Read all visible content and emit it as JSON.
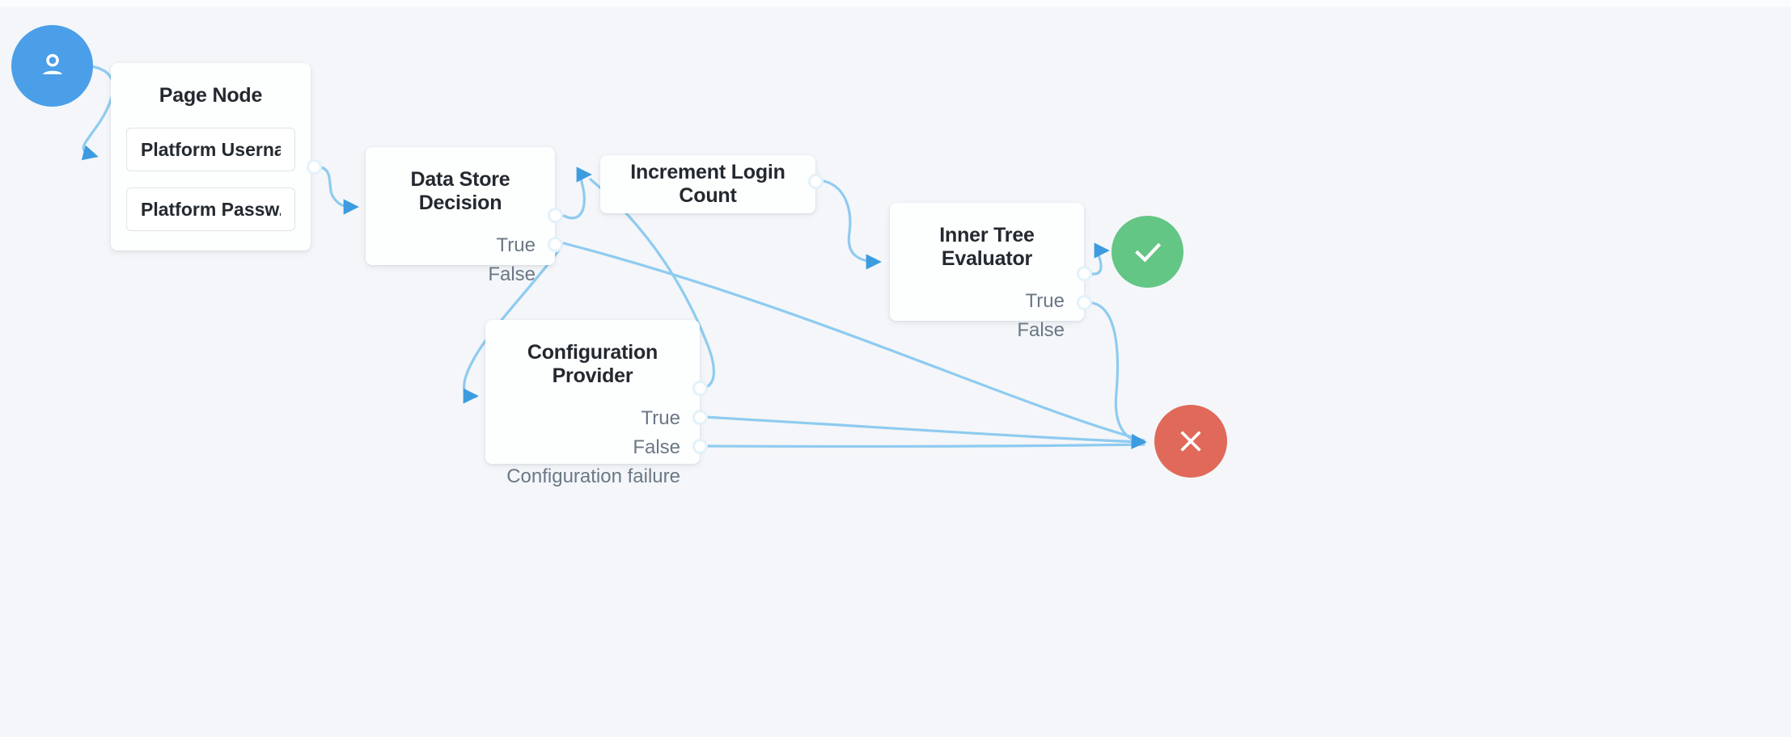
{
  "canvas": {
    "background_color": "#f4f6f9",
    "edge_color": "#8ecbf0",
    "arrow_color": "#3d9be0"
  },
  "terminals": {
    "start": {
      "name": "Start",
      "icon": "user-icon",
      "color": "#4a9fe8"
    },
    "success": {
      "name": "Success",
      "icon": "check-icon",
      "color": "#63c684"
    },
    "failure": {
      "name": "Failure",
      "icon": "close-icon",
      "color": "#e0695a"
    }
  },
  "nodes": {
    "page_node": {
      "title": "Page Node",
      "fields": [
        {
          "label": "Platform Userna..."
        },
        {
          "label": "Platform Passw..."
        }
      ]
    },
    "data_store_decision": {
      "title": "Data Store Decision",
      "outcomes": [
        {
          "label": "True"
        },
        {
          "label": "False"
        }
      ]
    },
    "increment_login_count": {
      "title": "Increment Login Count",
      "outcomes": []
    },
    "inner_tree_evaluator": {
      "title": "Inner Tree Evaluator",
      "outcomes": [
        {
          "label": "True"
        },
        {
          "label": "False"
        }
      ]
    },
    "configuration_provider": {
      "title": "Configuration Provider",
      "outcomes": [
        {
          "label": "True"
        },
        {
          "label": "False"
        },
        {
          "label": "Configuration failure"
        }
      ]
    }
  },
  "connections": [
    {
      "from": "Start",
      "to": "Page Node"
    },
    {
      "from": "Page Node",
      "to": "Data Store Decision"
    },
    {
      "from": "Data Store Decision / True",
      "to": "Increment Login Count"
    },
    {
      "from": "Data Store Decision / False",
      "to": "Configuration Provider"
    },
    {
      "from": "Data Store Decision / False",
      "to": "Failure"
    },
    {
      "from": "Increment Login Count",
      "to": "Inner Tree Evaluator"
    },
    {
      "from": "Inner Tree Evaluator / True",
      "to": "Success"
    },
    {
      "from": "Inner Tree Evaluator / False",
      "to": "Failure"
    },
    {
      "from": "Configuration Provider / True",
      "to": "Increment Login Count"
    },
    {
      "from": "Configuration Provider / False",
      "to": "Failure"
    },
    {
      "from": "Configuration Provider / Configuration failure",
      "to": "Failure"
    }
  ]
}
